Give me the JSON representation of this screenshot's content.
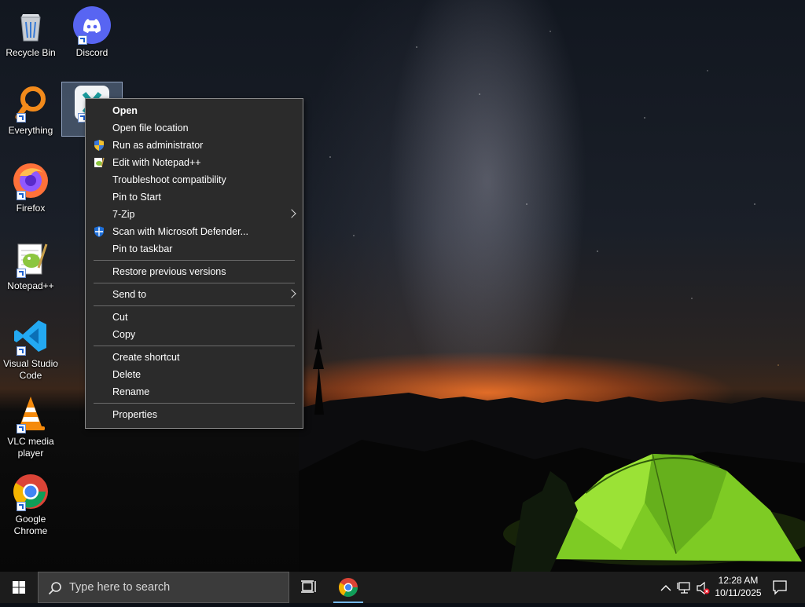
{
  "desktop": {
    "icons": [
      {
        "label": "Recycle Bin",
        "icon": "recycle-bin-icon"
      },
      {
        "label": "Discord",
        "icon": "discord-icon"
      },
      {
        "label": "Everything",
        "icon": "everything-search-icon"
      },
      {
        "label": "X-",
        "icon": "x-app-icon"
      },
      {
        "label": "Firefox",
        "icon": "firefox-icon"
      },
      {
        "label": "Notepad++",
        "icon": "notepadpp-icon"
      },
      {
        "label": "Visual Studio Code",
        "icon": "vscode-icon"
      },
      {
        "label": "VLC media player",
        "icon": "vlc-icon"
      },
      {
        "label": "Google Chrome",
        "icon": "chrome-icon"
      }
    ]
  },
  "context_menu": {
    "items": [
      {
        "label": "Open",
        "bold": true
      },
      {
        "label": "Open file location"
      },
      {
        "label": "Run as administrator",
        "icon": "uac-shield-icon"
      },
      {
        "label": "Edit with Notepad++",
        "icon": "notepadpp-icon"
      },
      {
        "label": "Troubleshoot compatibility"
      },
      {
        "label": "Pin to Start"
      },
      {
        "label": "7-Zip",
        "submenu": true
      },
      {
        "label": "Scan with Microsoft Defender...",
        "icon": "defender-icon"
      },
      {
        "label": "Pin to taskbar"
      },
      {
        "label": "Restore previous versions"
      },
      {
        "label": "Send to",
        "submenu": true
      },
      {
        "label": "Cut"
      },
      {
        "label": "Copy"
      },
      {
        "label": "Create shortcut"
      },
      {
        "label": "Delete"
      },
      {
        "label": "Rename"
      },
      {
        "label": "Properties"
      }
    ]
  },
  "taskbar": {
    "search_placeholder": "Type here to search",
    "time": "12:28 AM",
    "date": "10/11/2025",
    "accent": "#76b9ed"
  }
}
